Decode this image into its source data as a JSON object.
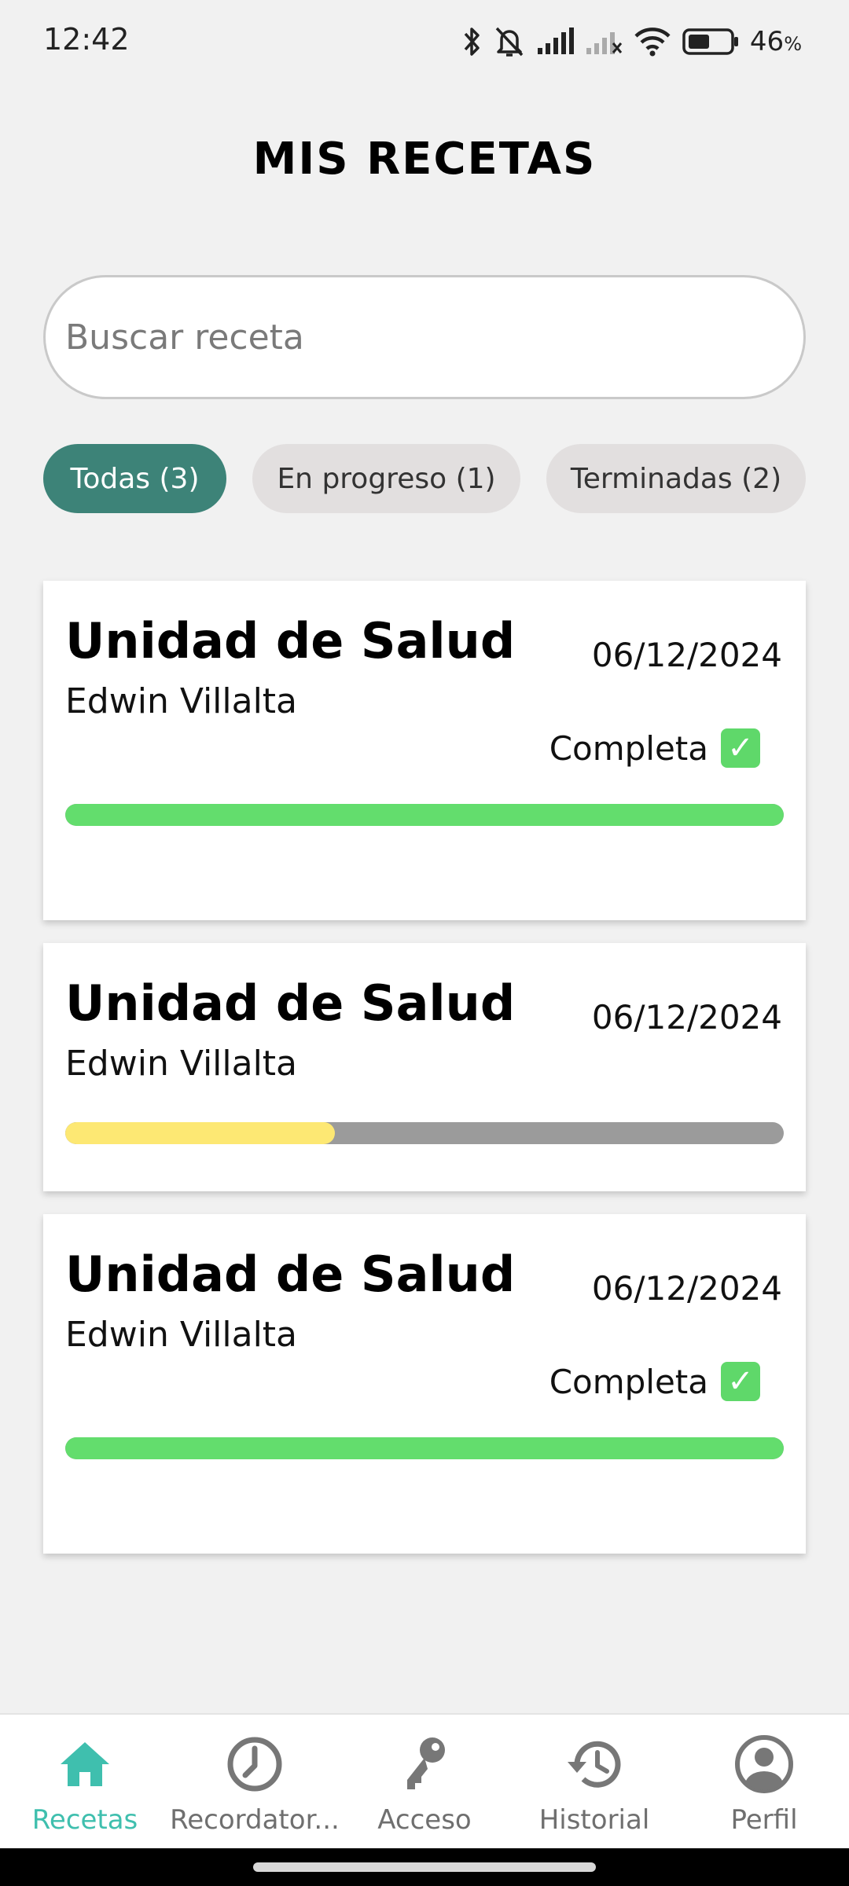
{
  "status_bar": {
    "time": "12:42",
    "battery_percent": "46",
    "battery_suffix": "%",
    "icons": [
      "bluetooth-icon",
      "bell-off-icon",
      "signal-icon",
      "signal-no-sim-icon",
      "wifi-icon",
      "battery-icon"
    ]
  },
  "page": {
    "title": "MIS RECETAS"
  },
  "search": {
    "placeholder": "Buscar receta",
    "value": ""
  },
  "filters": [
    {
      "label": "Todas (3)",
      "active": true
    },
    {
      "label": "En progreso (1)",
      "active": false
    },
    {
      "label": "Terminadas (2)",
      "active": false
    }
  ],
  "recipes": [
    {
      "title": "Unidad de Salud",
      "doctor": "Edwin Villalta",
      "date": "06/12/2024",
      "status": "Completa",
      "progress": 1.0,
      "progress_color": "#63dd6d"
    },
    {
      "title": "Unidad de Salud",
      "doctor": "Edwin Villalta",
      "date": "06/12/2024",
      "status": "",
      "progress": 0.375,
      "progress_color": "#fde873"
    },
    {
      "title": "Unidad de Salud",
      "doctor": "Edwin Villalta",
      "date": "06/12/2024",
      "status": "Completa",
      "progress": 1.0,
      "progress_color": "#63dd6d"
    }
  ],
  "nav": [
    {
      "label": "Recetas",
      "icon": "home-icon",
      "active": true
    },
    {
      "label": "Recordator...",
      "icon": "clock-icon",
      "active": false
    },
    {
      "label": "Acceso",
      "icon": "key-icon",
      "active": false
    },
    {
      "label": "Historial",
      "icon": "history-icon",
      "active": false
    },
    {
      "label": "Perfil",
      "icon": "user-icon",
      "active": false
    }
  ],
  "colors": {
    "accent": "#3d8378",
    "nav_active": "#3fbfae",
    "complete_green": "#63dd6d",
    "progress_yellow": "#fde873",
    "progress_track": "#9b9b9b"
  }
}
